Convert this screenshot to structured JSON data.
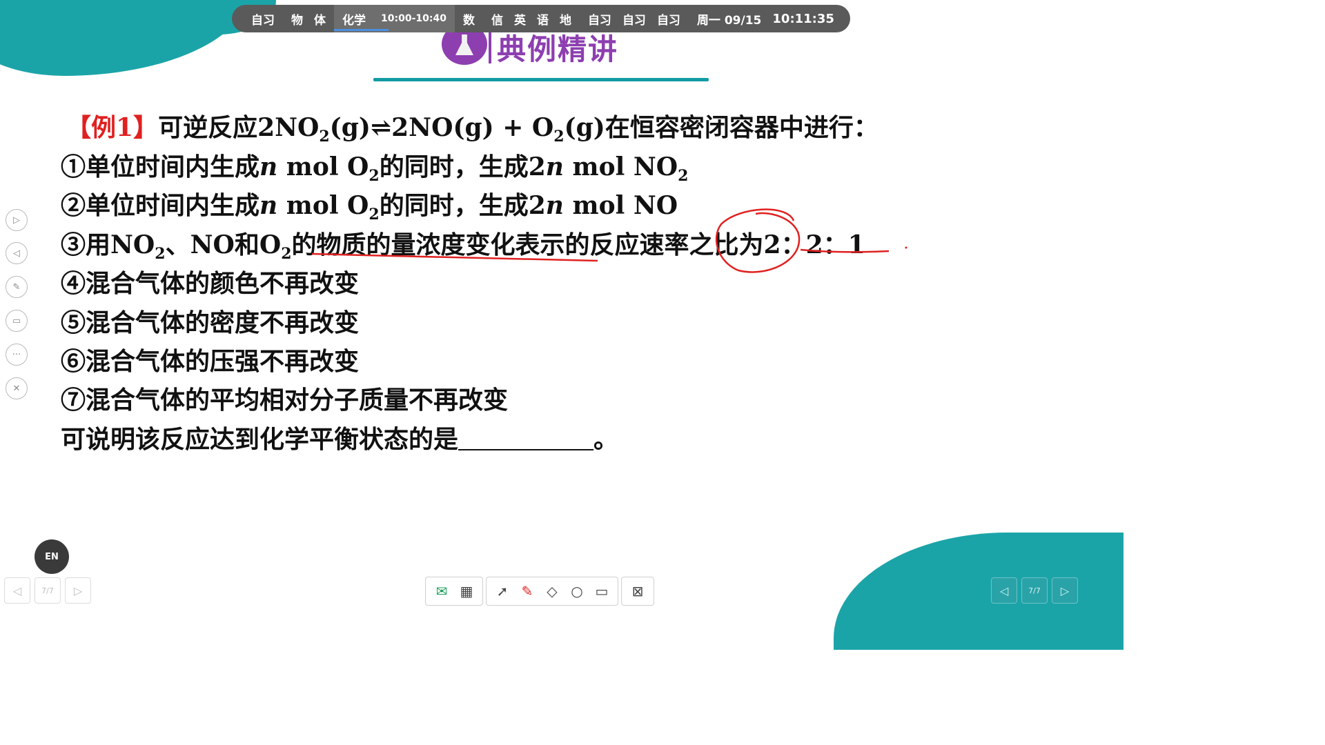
{
  "schedule_bar": {
    "items": [
      "自习",
      "物",
      "体",
      "化学",
      "数",
      "信",
      "英",
      "语",
      "地",
      "自习",
      "自习",
      "自习"
    ],
    "current_time_range": "10:00-10:40",
    "date": "周一 09/15",
    "clock": "10:11:35"
  },
  "slide": {
    "section_title": "典例精讲",
    "example_tag": "【例1】",
    "intro_a": "可逆反应2NO",
    "intro_sub": "2",
    "intro_b": "(g)",
    "intro_arrow": "⇌",
    "intro_c": "2NO(g) + O",
    "intro_sub2": "2",
    "intro_d": "(g)在恒容密闭容器中进行：",
    "item1_a": "①单位时间内生成",
    "item1_b": "n",
    "item1_c": " mol O",
    "item1_sub": "2",
    "item1_d": "的同时，生成2",
    "item1_e": "n",
    "item1_f": " mol NO",
    "item1_sub2": "2",
    "item2_a": "②单位时间内生成",
    "item2_b": "n",
    "item2_c": " mol O",
    "item2_sub": "2",
    "item2_d": "的同时，生成2",
    "item2_e": "n",
    "item2_f": " mol NO",
    "item3_a": "③用NO",
    "item3_sub": "2",
    "item3_b": "、NO和O",
    "item3_sub2": "2",
    "item3_c": "的物质的量浓度变化表示的反应速率之比为2：2：1",
    "item4": "④混合气体的颜色不再改变",
    "item5": "⑤混合气体的密度不再改变",
    "item6": "⑥混合气体的压强不再改变",
    "item7": "⑦混合气体的平均相对分子质量不再改变",
    "question": "可说明该反应达到化学平衡状态的是",
    "question_end": "。"
  },
  "side_tools": [
    "play-icon",
    "back-icon",
    "pen-icon",
    "screen-icon",
    "more-icon",
    "exit-icon"
  ],
  "language_badge": "EN",
  "page_indicator": "7/7",
  "page_indicator_right": "7/7",
  "colors": {
    "accent_teal": "#1ba4a8",
    "title_purple": "#8d3fb0",
    "example_red": "#e02020",
    "annotation_red": "#e02020"
  }
}
